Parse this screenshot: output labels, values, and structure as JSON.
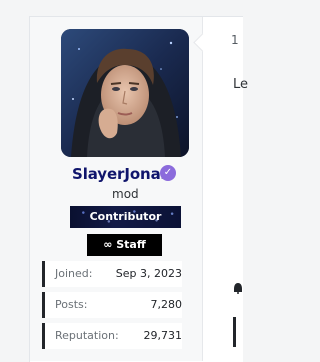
{
  "post": {
    "number": "1",
    "message_preview": "Le"
  },
  "user": {
    "username": "SlayerJonas",
    "verified_icon": "check-badge-icon",
    "title": "mod",
    "banners": [
      {
        "label": "Contributor"
      },
      {
        "label": "∞ Staff"
      }
    ],
    "stats": [
      {
        "label": "Joined:",
        "value": "Sep 3, 2023"
      },
      {
        "label": "Posts:",
        "value": "7,280"
      },
      {
        "label": "Reputation:",
        "value": "29,731"
      }
    ]
  },
  "colors": {
    "username": "#10156c",
    "verified": "#8b6bdc",
    "staff_banner": "#000000"
  }
}
